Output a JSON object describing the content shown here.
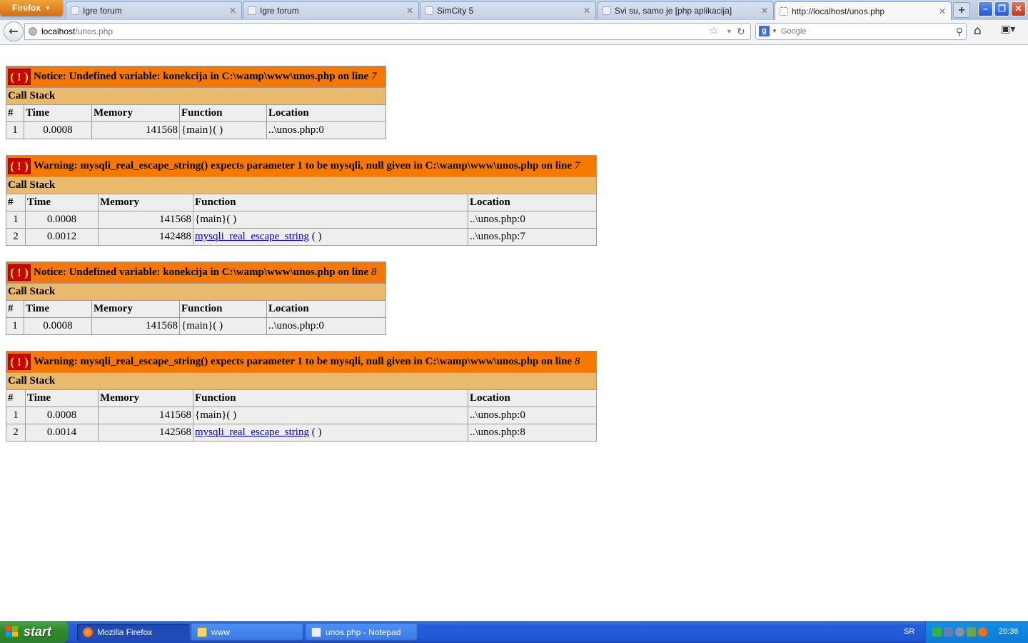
{
  "browser": {
    "app_button": "Firefox",
    "tabs": [
      {
        "title": "Igre forum",
        "active": false
      },
      {
        "title": "Igre forum",
        "active": false
      },
      {
        "title": "SimCity 5",
        "active": false
      },
      {
        "title": "Svi su, samo je [php aplikacija]",
        "active": false
      },
      {
        "title": "http://localhost/unos.php",
        "active": true
      }
    ],
    "new_tab_label": "+",
    "url_host": "localhost",
    "url_path": "/unos.php",
    "search_engine": "g",
    "search_placeholder": "Google",
    "window_buttons": {
      "minimize": "–",
      "restore": "❐",
      "close": "✕"
    }
  },
  "page": {
    "call_stack_label": "Call Stack",
    "columns": [
      "#",
      "Time",
      "Memory",
      "Function",
      "Location"
    ],
    "error_icon": "( ! )",
    "errors": [
      {
        "message": "Notice: Undefined variable: konekcija in C:\\wamp\\www\\unos.php on line",
        "line": "7",
        "rows": [
          {
            "n": "1",
            "time": "0.0008",
            "memory": "141568",
            "function": "{main}( )",
            "location": "..\\unos.php:0"
          }
        ]
      },
      {
        "message": "Warning: mysqli_real_escape_string() expects parameter 1 to be mysqli, null given in C:\\wamp\\www\\unos.php on line",
        "line": "7",
        "rows": [
          {
            "n": "1",
            "time": "0.0008",
            "memory": "141568",
            "function": "{main}( )",
            "location": "..\\unos.php:0"
          },
          {
            "n": "2",
            "time": "0.0012",
            "memory": "142488",
            "function_link": "mysqli_real_escape_string",
            "function_suffix": " ( )",
            "location": "..\\unos.php:7"
          }
        ]
      },
      {
        "message": "Notice: Undefined variable: konekcija in C:\\wamp\\www\\unos.php on line",
        "line": "8",
        "rows": [
          {
            "n": "1",
            "time": "0.0008",
            "memory": "141568",
            "function": "{main}( )",
            "location": "..\\unos.php:0"
          }
        ]
      },
      {
        "message": "Warning: mysqli_real_escape_string() expects parameter 1 to be mysqli, null given in C:\\wamp\\www\\unos.php on line",
        "line": "8",
        "rows": [
          {
            "n": "1",
            "time": "0.0008",
            "memory": "141568",
            "function": "{main}( )",
            "location": "..\\unos.php:0"
          },
          {
            "n": "2",
            "time": "0.0014",
            "memory": "142568",
            "function_link": "mysqli_real_escape_string",
            "function_suffix": " ( )",
            "location": "..\\unos.php:8"
          }
        ]
      }
    ]
  },
  "taskbar": {
    "start_label": "start",
    "buttons": [
      {
        "label": "Mozilla Firefox",
        "icon": "firefox-icon"
      },
      {
        "label": "www",
        "icon": "folder-icon"
      },
      {
        "label": "unos.php - Notepad",
        "icon": "notepad-icon"
      }
    ],
    "language": "SR",
    "clock": "20:36"
  },
  "colors": {
    "error_header": "#f57900",
    "call_stack_header": "#e9b96e",
    "table_cell": "#eeeeec",
    "error_icon_bg": "#cc0000",
    "error_icon_fg": "#fce94f"
  }
}
